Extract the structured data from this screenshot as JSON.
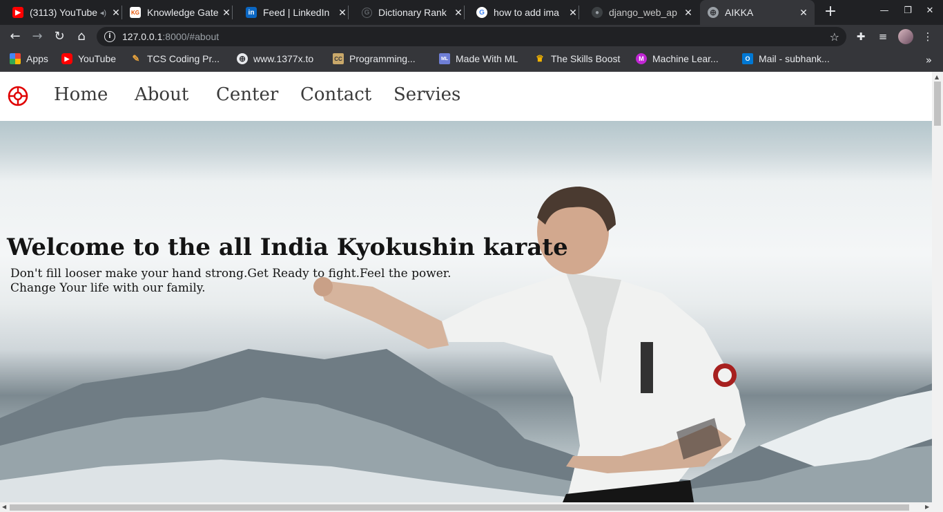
{
  "browser": {
    "tabs": [
      {
        "title": "(3113) YouTube",
        "icon": "youtube-icon",
        "color": "#ff0000",
        "glyph": "▶"
      },
      {
        "title": "Knowledge Gate",
        "icon": "knowledge-gate-icon",
        "color": "#ffffff",
        "glyph": "KG"
      },
      {
        "title": "Feed | LinkedIn",
        "icon": "linkedin-icon",
        "color": "#0a66c2",
        "glyph": "in"
      },
      {
        "title": "Dictionary Rank",
        "icon": "globe-icon",
        "color": "#5f6368",
        "glyph": "G"
      },
      {
        "title": "how to add ima",
        "icon": "google-icon",
        "color": "#4285f4",
        "glyph": "G"
      },
      {
        "title": "django_web_ap",
        "icon": "github-icon",
        "color": "#5f6368",
        "glyph": "◯"
      },
      {
        "title": "AIKKA",
        "icon": "globe-icon",
        "color": "#9aa0a6",
        "glyph": "⊕"
      }
    ],
    "url_host": "127.0.0.1",
    "url_rest": ":8000/#about",
    "bookmarks": [
      {
        "label": "Apps",
        "icon": "apps-grid-icon",
        "color": "#4285f4",
        "glyph": "⁞⁞"
      },
      {
        "label": "YouTube",
        "icon": "youtube-icon",
        "color": "#ff0000",
        "glyph": "▶"
      },
      {
        "label": "TCS Coding Pr...",
        "icon": "tcs-icon",
        "color": "#e8a33d",
        "glyph": "✎"
      },
      {
        "label": "www.1377x.to",
        "icon": "globe-icon",
        "color": "#5f6368",
        "glyph": "⊕"
      },
      {
        "label": "Programming...",
        "icon": "cc-icon",
        "color": "#c9a86a",
        "glyph": "CC"
      },
      {
        "label": "Made With ML",
        "icon": "ml-icon",
        "color": "#6f7fd6",
        "glyph": "ML"
      },
      {
        "label": "The Skills Boost",
        "icon": "trophy-icon",
        "color": "#f4b400",
        "glyph": "♛"
      },
      {
        "label": "Machine Lear...",
        "icon": "m-icon",
        "color": "#c026d3",
        "glyph": "M"
      },
      {
        "label": "Mail - subhank...",
        "icon": "outlook-icon",
        "color": "#0078d4",
        "glyph": "O"
      }
    ]
  },
  "site": {
    "nav": [
      "Home",
      "About",
      "Center",
      "Contact",
      "Servies"
    ],
    "hero_title": "Welcome to the all India Kyokushin karate",
    "hero_sub_1": "Don't fill looser make your hand strong.Get Ready to fight.Feel the power.",
    "hero_sub_2": "Change Your life with our family.",
    "logo_color": "#e00000"
  }
}
